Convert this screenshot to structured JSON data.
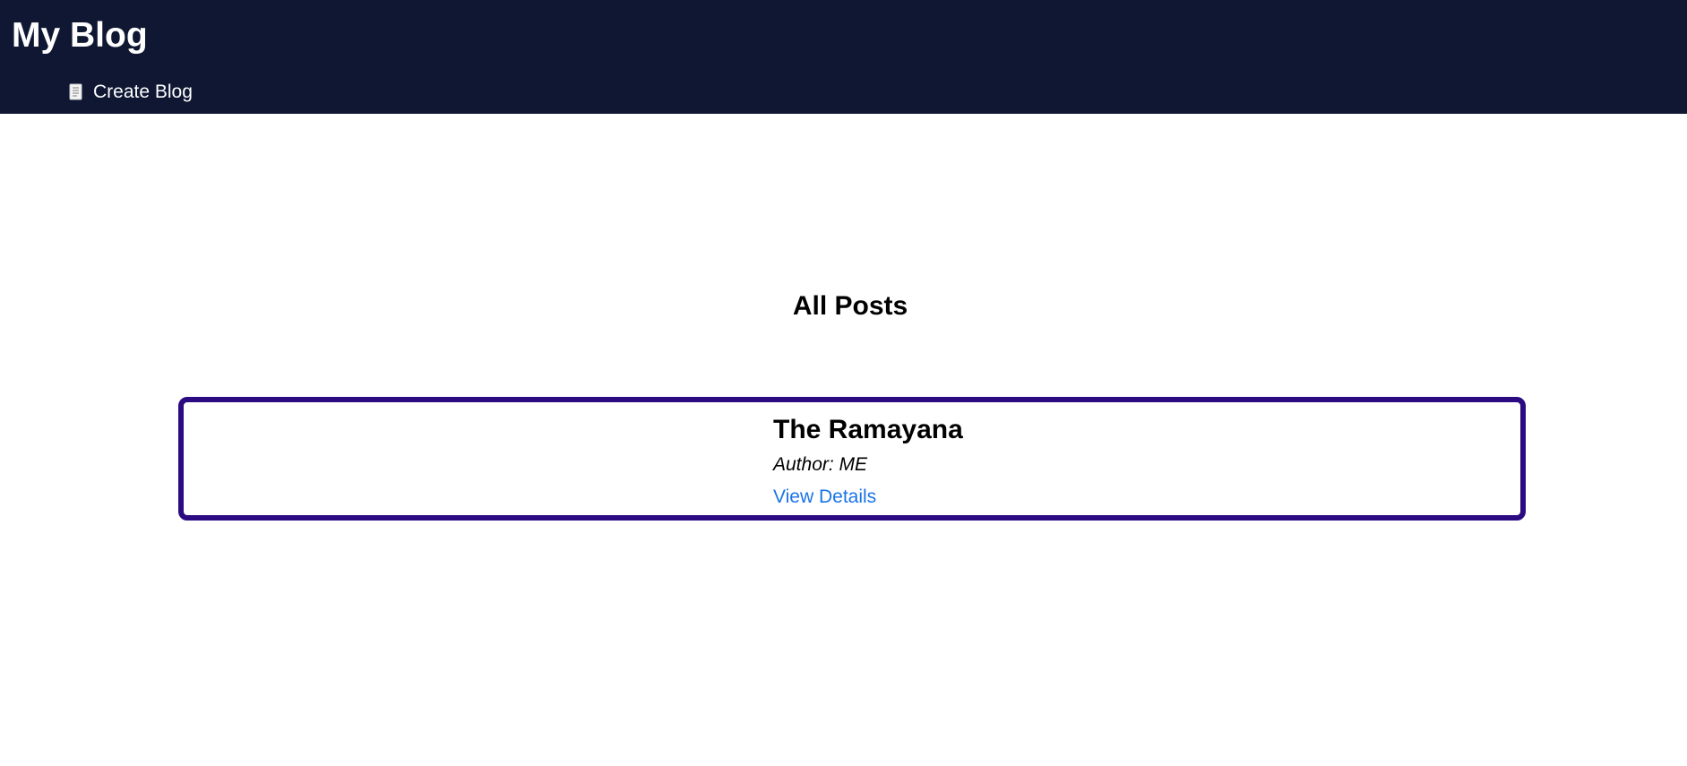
{
  "header": {
    "title": "My Blog",
    "nav": {
      "icon": "document-icon",
      "label": "Create Blog"
    },
    "background_color": "#0f1733"
  },
  "main": {
    "heading": "All Posts",
    "posts": [
      {
        "title": "The Ramayana",
        "author": "Author: ME",
        "link_label": "View Details"
      }
    ],
    "card_border_color": "#2c0b82",
    "link_color": "#1a73e8"
  }
}
